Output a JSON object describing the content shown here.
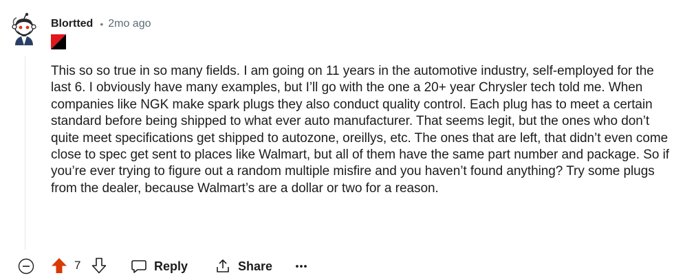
{
  "comment": {
    "username": "Blortted",
    "separator": "•",
    "time_ago": "2mo ago",
    "body": "This so so true in so many fields. I am going on 11 years in the automotive industry, self-employed for the last 6. I obviously have many examples, but I’ll go with the one a 20+ year Chrysler tech told me. When companies like NGK make spark plugs they also conduct quality control. Each plug has to meet a certain standard before being shipped to what ever auto manufacturer. That seems legit, but the ones who don’t quite meet specifications get shipped to autozone, oreillys, etc. The ones that are left, that didn’t even come close to spec get sent to places like Walmart, but all of them have the same part number and package. So if you’re ever trying to figure out a random multiple misfire and you haven’t found anything? Try some plugs from the dealer, because Walmart’s are a dollar or two for a reason."
  },
  "actions": {
    "score": "7",
    "reply_label": "Reply",
    "share_label": "Share",
    "more_label": "•••"
  },
  "colors": {
    "upvote_active": "#d93a00",
    "flair_red": "#e0171b",
    "flair_black": "#000000"
  },
  "icons": {
    "collapse": "minus-circle-icon",
    "upvote": "arrow-up-icon",
    "downvote": "arrow-down-icon",
    "reply": "speech-bubble-icon",
    "share": "share-icon",
    "more": "ellipsis-icon",
    "avatar": "snoo-avatar-icon",
    "flair": "flair-icon"
  }
}
